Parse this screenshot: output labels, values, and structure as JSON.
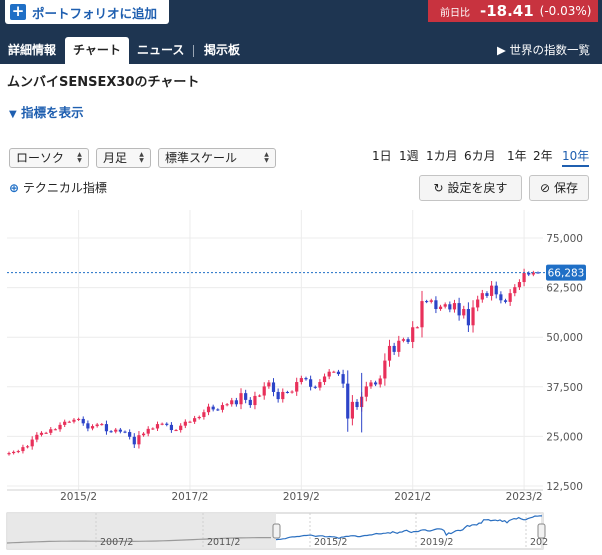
{
  "header": {
    "portfolio_add_label": "ポートフォリオに追加",
    "change_caption": "前日比",
    "change_value": "-18.41",
    "change_percent": "(-0.03%)"
  },
  "tabs": [
    {
      "label": "詳細情報"
    },
    {
      "label": "チャート",
      "active": true
    },
    {
      "label": "ニュース"
    },
    {
      "label": "掲示板"
    }
  ],
  "world_link": "世界の指数一覧",
  "page_title": "ムンバイSENSEX30のチャート",
  "show_indicators": "指標を表示",
  "selects": {
    "chart_type": "ローソク",
    "interval": "月足",
    "scale": "標準スケール"
  },
  "periods": [
    "1日",
    "1週",
    "1カ月",
    "6カ月",
    "1年",
    "2年",
    "10年"
  ],
  "active_period": "10年",
  "technical_indicators": "テクニカル指標",
  "reset_button": "設定を戻す",
  "save_button": "保存",
  "colors": {
    "up": "#e8305a",
    "down": "#2d44c8",
    "accent": "#1f6fc6",
    "header": "#1e3551"
  },
  "chart_data": {
    "type": "candlestick",
    "interval": "monthly",
    "x_start": "2013/11",
    "x_tick_labels": [
      "2015/2",
      "2017/2",
      "2019/2",
      "2021/2",
      "2023/2"
    ],
    "y_tick_labels": [
      "75,000",
      "62,500",
      "50,000",
      "37,500",
      "25,000",
      "12,500"
    ],
    "ylim": [
      12500,
      75000
    ],
    "last_price_label": "66,283",
    "last_price": 66283,
    "close": [
      20800,
      21100,
      21300,
      22300,
      22500,
      24200,
      25400,
      25900,
      25900,
      26800,
      26800,
      27900,
      28700,
      28700,
      29200,
      29400,
      28300,
      27000,
      27600,
      28000,
      28100,
      26300,
      26200,
      26700,
      26200,
      26100,
      24900,
      23000,
      25300,
      25700,
      26900,
      27000,
      28100,
      28200,
      27900,
      26600,
      26600,
      27700,
      28700,
      28700,
      29600,
      29900,
      31100,
      32500,
      31800,
      31700,
      32900,
      33100,
      34100,
      33100,
      35900,
      34200,
      32900,
      35200,
      35300,
      37600,
      38600,
      36200,
      34400,
      36200,
      36100,
      36300,
      38700,
      39700,
      39400,
      37500,
      37300,
      38700,
      40100,
      41300,
      41300,
      40700,
      38300,
      29500,
      33700,
      32400,
      35000,
      37600,
      38600,
      38100,
      39600,
      44100,
      47800,
      46300,
      49100,
      49500,
      48800,
      52500,
      52500,
      59100,
      58900,
      59300,
      57100,
      57700,
      58300,
      57000,
      58600,
      55500,
      57100,
      53000,
      57500,
      59500,
      61100,
      60400,
      63000,
      60800,
      59300,
      58900,
      61100,
      62600,
      63900,
      66200,
      65800,
      66300,
      66283
    ]
  }
}
